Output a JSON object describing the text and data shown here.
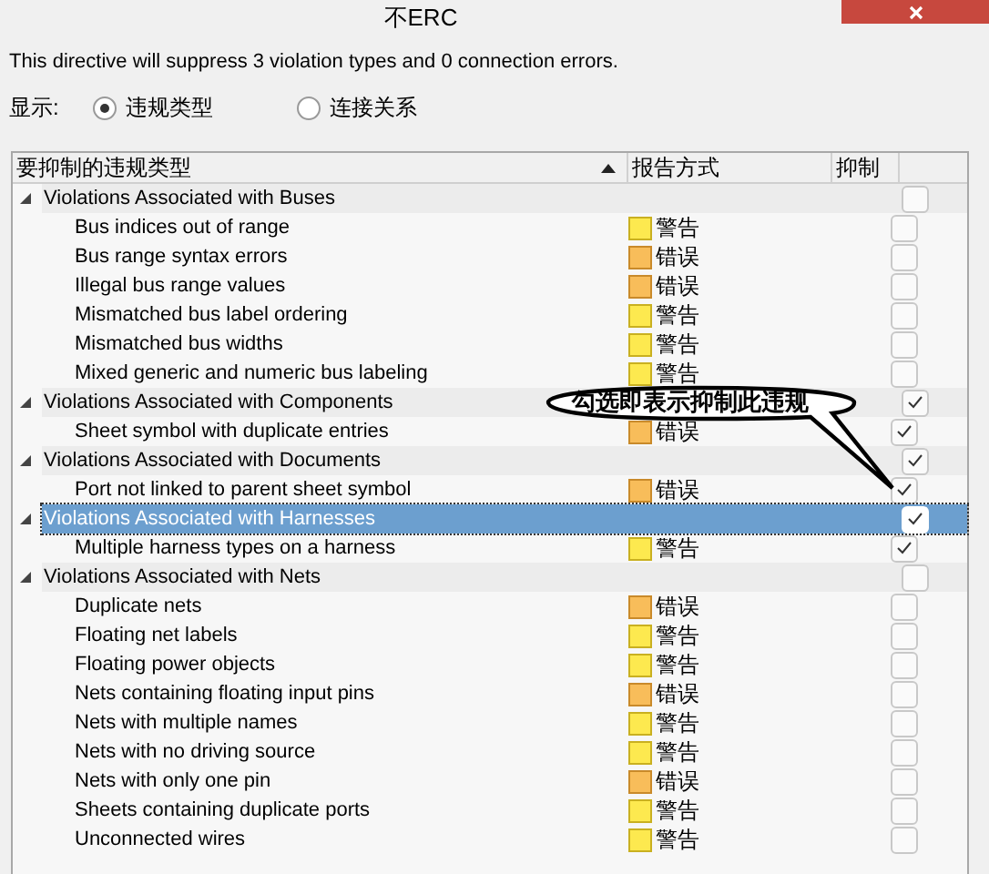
{
  "window": {
    "title": "不ERC"
  },
  "summary": "This directive will suppress 3 violation types and 0 connection errors.",
  "display": {
    "label": "显示:",
    "options": [
      {
        "label": "违规类型",
        "selected": true
      },
      {
        "label": "连接关系",
        "selected": false
      }
    ]
  },
  "table": {
    "columns": [
      {
        "label": "要抑制的违规类型",
        "sorted": true
      },
      {
        "label": "报告方式",
        "sorted": false
      },
      {
        "label": "抑制",
        "sorted": false
      }
    ],
    "groups": [
      {
        "name": "Violations Associated with Buses",
        "expanded": true,
        "selected": false,
        "suppressed": false,
        "children": [
          {
            "name": "Bus indices out of range",
            "report": {
              "kind": "warning",
              "label": "警告"
            },
            "suppressed": false
          },
          {
            "name": "Bus range syntax errors",
            "report": {
              "kind": "error",
              "label": "错误"
            },
            "suppressed": false
          },
          {
            "name": "Illegal bus range values",
            "report": {
              "kind": "error",
              "label": "错误"
            },
            "suppressed": false
          },
          {
            "name": "Mismatched bus label ordering",
            "report": {
              "kind": "warning",
              "label": "警告"
            },
            "suppressed": false
          },
          {
            "name": "Mismatched bus widths",
            "report": {
              "kind": "warning",
              "label": "警告"
            },
            "suppressed": false
          },
          {
            "name": "Mixed generic and numeric bus labeling",
            "report": {
              "kind": "warning",
              "label": "警告"
            },
            "suppressed": false
          }
        ]
      },
      {
        "name": "Violations Associated with Components",
        "expanded": true,
        "selected": false,
        "suppressed": true,
        "children": [
          {
            "name": "Sheet symbol with duplicate entries",
            "report": {
              "kind": "error",
              "label": "错误"
            },
            "suppressed": true
          }
        ]
      },
      {
        "name": "Violations Associated with Documents",
        "expanded": true,
        "selected": false,
        "suppressed": true,
        "children": [
          {
            "name": "Port not linked to parent sheet symbol",
            "report": {
              "kind": "error",
              "label": "错误"
            },
            "suppressed": true
          }
        ]
      },
      {
        "name": "Violations Associated with Harnesses",
        "expanded": true,
        "selected": true,
        "suppressed": true,
        "children": [
          {
            "name": "Multiple harness types on a harness",
            "report": {
              "kind": "warning",
              "label": "警告"
            },
            "suppressed": true
          }
        ]
      },
      {
        "name": "Violations Associated with Nets",
        "expanded": true,
        "selected": false,
        "suppressed": false,
        "children": [
          {
            "name": "Duplicate nets",
            "report": {
              "kind": "error",
              "label": "错误"
            },
            "suppressed": false
          },
          {
            "name": "Floating net labels",
            "report": {
              "kind": "warning",
              "label": "警告"
            },
            "suppressed": false
          },
          {
            "name": "Floating power objects",
            "report": {
              "kind": "warning",
              "label": "警告"
            },
            "suppressed": false
          },
          {
            "name": "Nets containing floating input pins",
            "report": {
              "kind": "error",
              "label": "错误"
            },
            "suppressed": false
          },
          {
            "name": "Nets with multiple names",
            "report": {
              "kind": "warning",
              "label": "警告"
            },
            "suppressed": false
          },
          {
            "name": "Nets with no driving source",
            "report": {
              "kind": "warning",
              "label": "警告"
            },
            "suppressed": false
          },
          {
            "name": "Nets with only one pin",
            "report": {
              "kind": "error",
              "label": "错误"
            },
            "suppressed": false
          },
          {
            "name": "Sheets containing duplicate ports",
            "report": {
              "kind": "warning",
              "label": "警告"
            },
            "suppressed": false
          },
          {
            "name": "Unconnected wires",
            "report": {
              "kind": "warning",
              "label": "警告"
            },
            "suppressed": false
          }
        ]
      }
    ]
  },
  "callout": {
    "text": "勾选即表示抑制此违规"
  }
}
